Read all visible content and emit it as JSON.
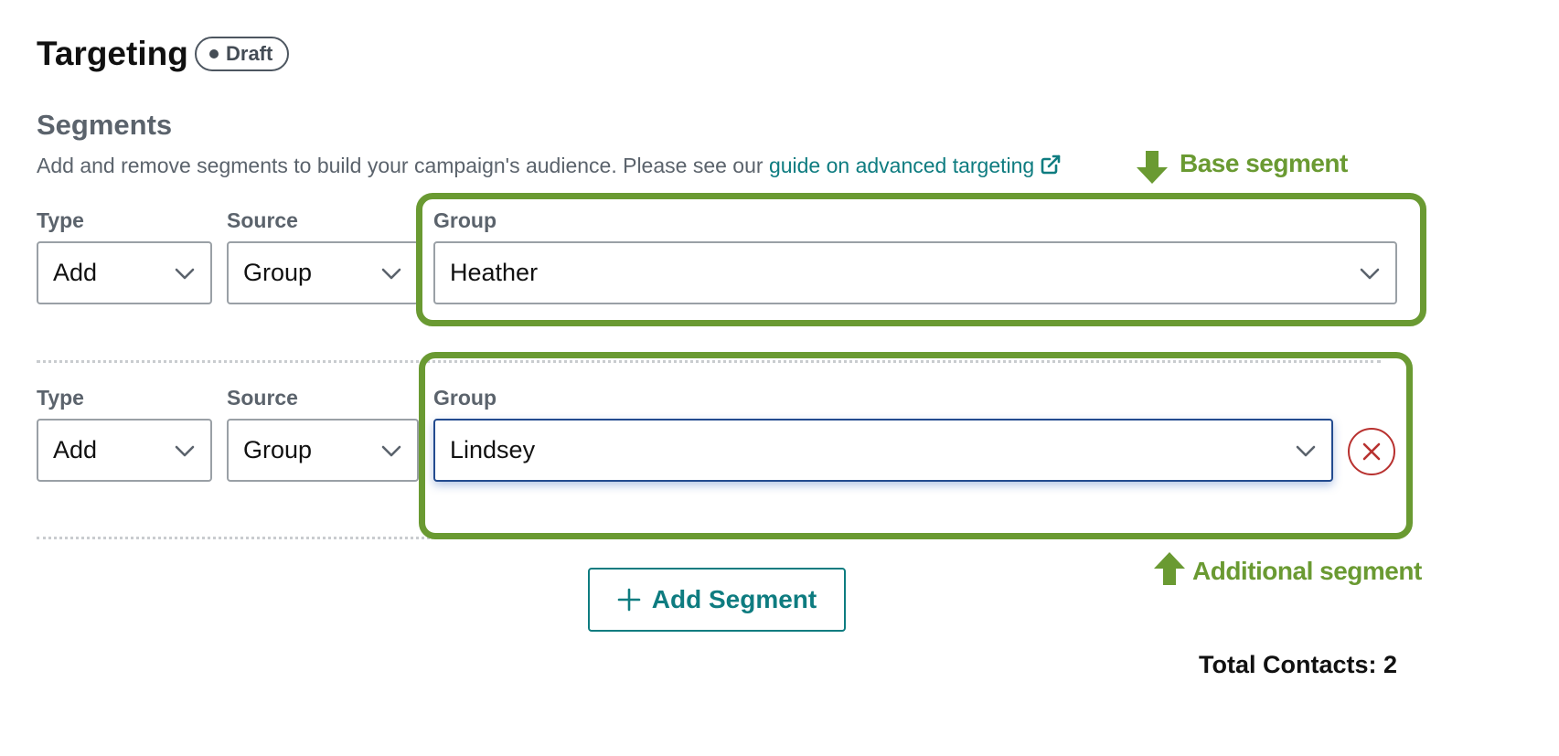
{
  "header": {
    "title": "Targeting",
    "status_badge": "Draft"
  },
  "segments_section": {
    "heading": "Segments",
    "description": "Add and remove segments to build your campaign's audience. Please see our ",
    "guide_link": "guide on advanced targeting"
  },
  "segments": [
    {
      "type_label": "Type",
      "type_value": "Add",
      "source_label": "Source",
      "source_value": "Group",
      "group_label": "Group",
      "group_value": "Heather"
    },
    {
      "type_label": "Type",
      "type_value": "Add",
      "source_label": "Source",
      "source_value": "Group",
      "group_label": "Group",
      "group_value": "Lindsey"
    }
  ],
  "add_segment_label": "Add Segment",
  "total_contacts": "Total Contacts: 2",
  "annotations": {
    "base": "Base segment",
    "additional": "Additional segment"
  },
  "colors": {
    "accent": "#0e7c80",
    "annotation": "#6a9a32",
    "danger": "#b8312f",
    "focus": "#234b8f"
  },
  "icons": [
    "external-link-icon",
    "chevron-down-icon",
    "close-icon",
    "plus-icon",
    "arrow-down-icon",
    "arrow-up-icon"
  ]
}
